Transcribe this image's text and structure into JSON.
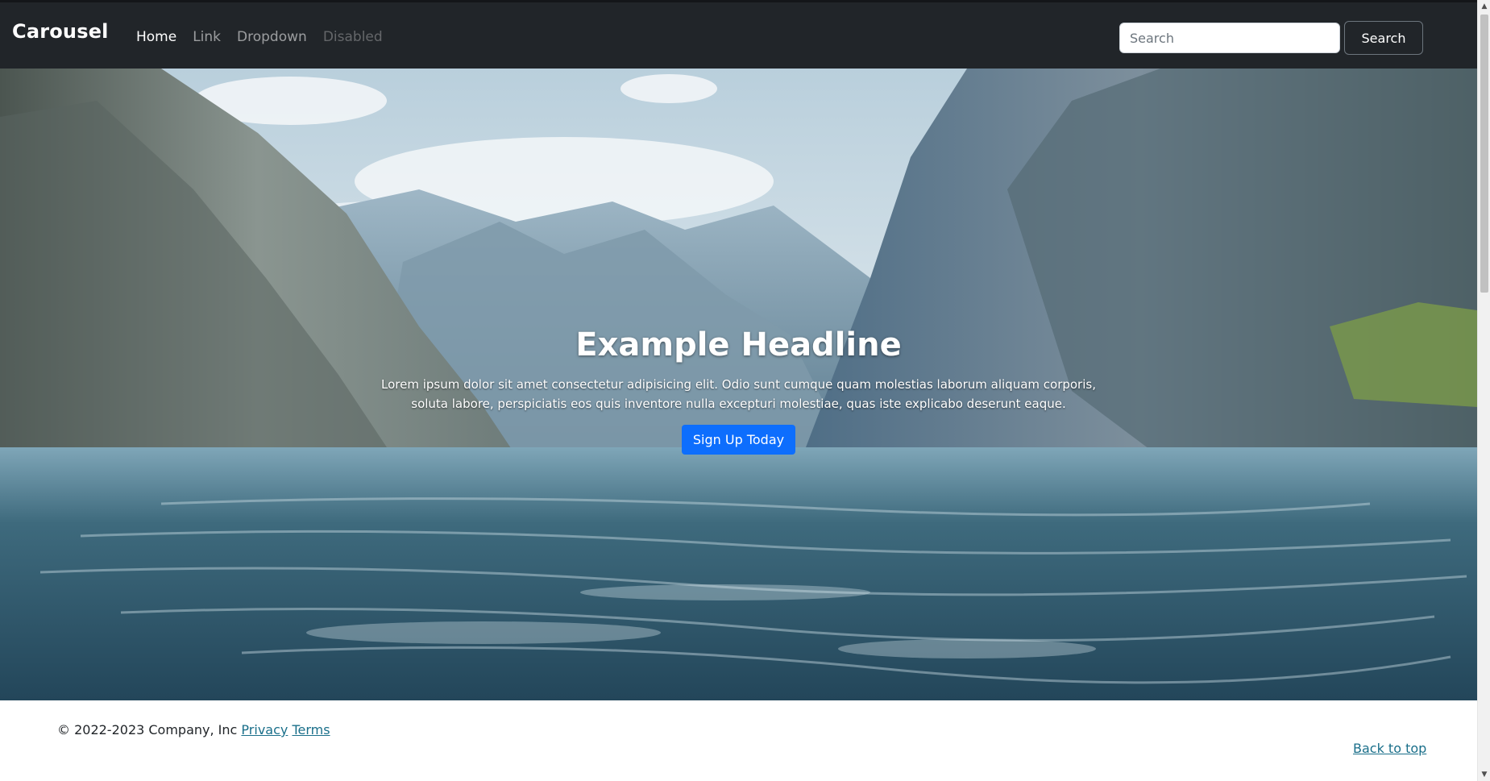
{
  "navbar": {
    "brand": "Carousel",
    "links": [
      {
        "label": "Home",
        "state": "active"
      },
      {
        "label": "Link",
        "state": "normal"
      },
      {
        "label": "Dropdown",
        "state": "normal"
      },
      {
        "label": "Disabled",
        "state": "disabled"
      }
    ],
    "search_placeholder": "Search",
    "search_button_label": "Search"
  },
  "hero": {
    "headline": "Example Headline",
    "body": "Lorem ipsum dolor sit amet consectetur adipisicing elit. Odio sunt cumque quam molestias laborum aliquam corporis, soluta labore, perspiciatis eos quis inventore nulla excepturi molestiae, quas iste explicabo deserunt eaque.",
    "cta_label": "Sign Up Today"
  },
  "footer": {
    "copyright": "© 2022-2023 Company, Inc",
    "privacy_label": "Privacy",
    "terms_label": "Terms",
    "back_to_top_label": "Back to top"
  },
  "colors": {
    "navbar_bg": "#212529",
    "primary_button": "#0d6efd",
    "footer_link": "#1a6f8a"
  }
}
